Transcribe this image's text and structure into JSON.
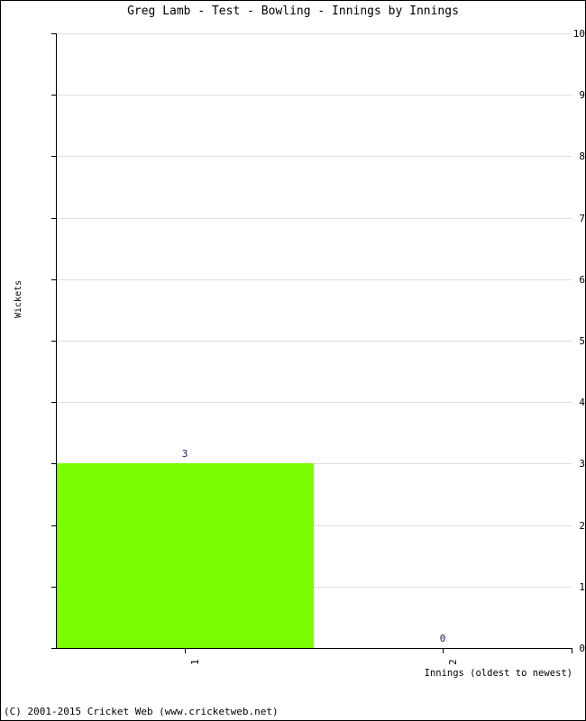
{
  "chart_data": {
    "type": "bar",
    "title": "Greg Lamb - Test - Bowling - Innings by Innings",
    "xlabel": "Innings (oldest to newest)",
    "ylabel": "Wickets",
    "categories": [
      "1",
      "2"
    ],
    "values": [
      3,
      0
    ],
    "data_labels": [
      "3",
      "0"
    ],
    "ylim": [
      0,
      10
    ],
    "ytick_labels": [
      "0",
      "1",
      "2",
      "3",
      "4",
      "5",
      "6",
      "7",
      "8",
      "9",
      "10"
    ],
    "ytick_values": [
      0,
      1,
      2,
      3,
      4,
      5,
      6,
      7,
      8,
      9,
      10
    ],
    "grid": true,
    "legend": "none",
    "bar_color": "#7CFC00",
    "label_color": "#19197A",
    "gridline_color": "#DDDDDD",
    "axis_color": "#000000",
    "background_color": "#FFFFFF"
  },
  "footer": {
    "copyright": "(C) 2001-2015 Cricket Web (www.cricketweb.net)"
  }
}
